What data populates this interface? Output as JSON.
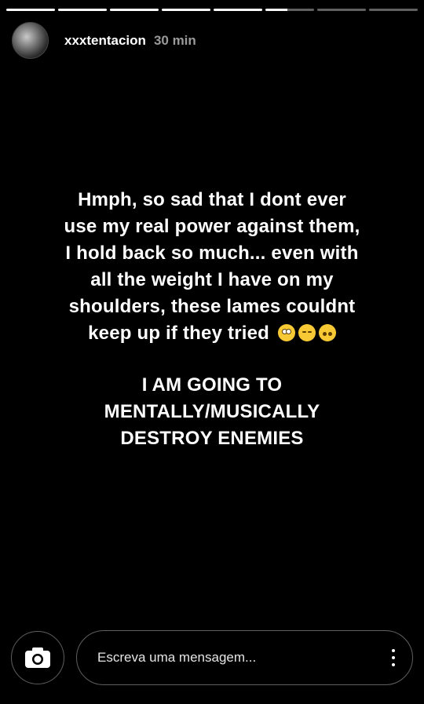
{
  "progress": {
    "segments": 8,
    "completed": 5,
    "active_index": 5,
    "active_fraction": 0.45
  },
  "header": {
    "username": "xxxtentacion",
    "time": "30 min"
  },
  "story": {
    "text": "Hmph, so sad that I dont ever use my real power against them, I hold back so much... even with all the weight I have on my shoulders, these lames couldnt keep up if they tried",
    "emojis": [
      "face-with-rolling-eyes",
      "relieved-face",
      "upside-down-face"
    ],
    "shout": "I AM GOING TO MENTALLY/MUSICALLY DESTROY ENEMIES"
  },
  "footer": {
    "camera_icon": "camera-icon",
    "message_placeholder": "Escreva uma mensagem...",
    "more_icon": "more-vertical-icon"
  },
  "colors": {
    "background": "#000000",
    "text": "#ffffff",
    "muted": "#9a9a9a"
  }
}
